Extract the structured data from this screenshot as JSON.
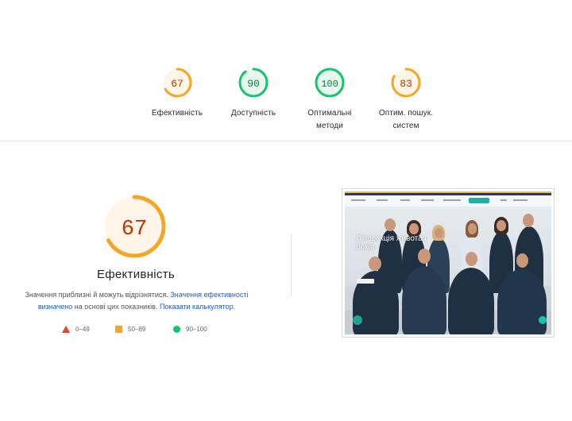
{
  "top_scores": [
    {
      "score": "67",
      "label_line1": "Ефективність",
      "label_line2": "",
      "status": "average",
      "value": 67
    },
    {
      "score": "90",
      "label_line1": "Доступність",
      "label_line2": "",
      "status": "pass",
      "value": 90
    },
    {
      "score": "100",
      "label_line1": "Оптимальні",
      "label_line2": "методи",
      "status": "pass",
      "value": 100
    },
    {
      "score": "83",
      "label_line1": "Оптим. пошук.",
      "label_line2": "систем",
      "status": "average",
      "value": 83
    }
  ],
  "main": {
    "score": "67",
    "value": 67,
    "title": "Ефективність",
    "note_prefix": "Значення приблизні й можуть відрізнятися. ",
    "note_link1": "Значення ефективності визначено",
    "note_middle": " на основі цих показників. ",
    "note_link2": "Показати калькулятор."
  },
  "legend": [
    {
      "range": "0–49",
      "shape": "triangle",
      "color": "#e8412f"
    },
    {
      "range": "50–89",
      "shape": "square",
      "color": "#f5a623"
    },
    {
      "range": "90–100",
      "shape": "circle",
      "color": "#0fc66a"
    }
  ],
  "screenshot": {
    "heading": "Ліпосакція живота і боків"
  },
  "colors": {
    "average_ring": "#f5a623",
    "average_text": "#c33300",
    "average_fill": "#fff5e8",
    "pass_ring": "#0fc66a",
    "pass_text": "#0a7f3e",
    "pass_fill": "#e8f8ee"
  }
}
